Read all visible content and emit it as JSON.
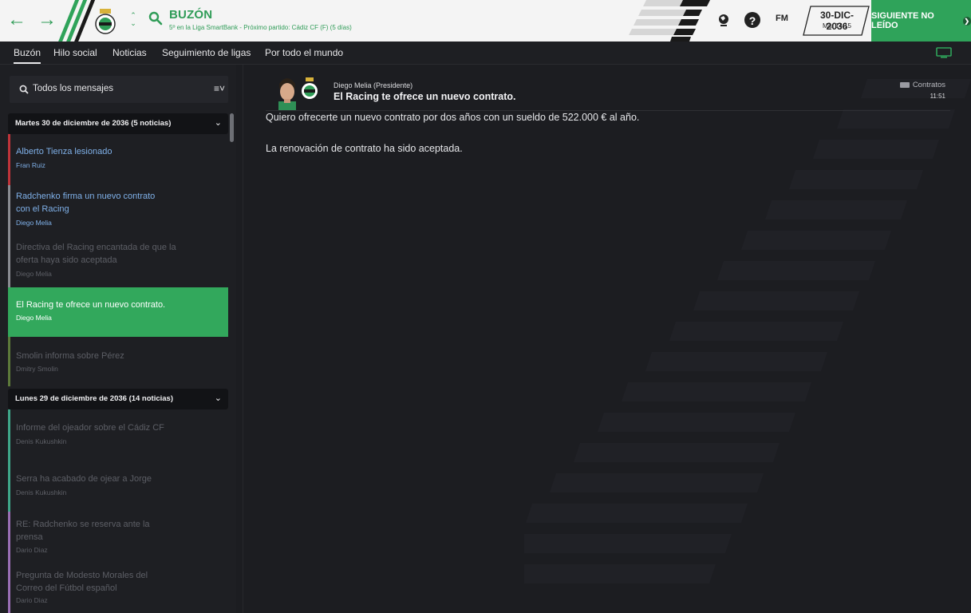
{
  "header": {
    "title": "BUZÓN",
    "subtitle": "5º en la Liga SmartBank - Próximo partido: Cádiz CF (F)  (5 días)",
    "date": "30-DIC-2036",
    "weekday_time": "Mar 14:15",
    "fm_logo": "FM",
    "help_label": "?",
    "continue_label": "SIGUIENTE NO LEÍDO",
    "icons": [
      "back-arrow-icon",
      "forward-arrow-icon",
      "club-crest-icon",
      "up-down-chevron-icon",
      "search-icon",
      "world-icon",
      "help-icon",
      "fm-logo-icon",
      "continue-arrow-icon"
    ],
    "brand_color": "#2fa35a"
  },
  "tabs": [
    {
      "label": "Buzón",
      "active": true
    },
    {
      "label": "Hilo social",
      "active": false
    },
    {
      "label": "Noticias",
      "active": false
    },
    {
      "label": "Seguimiento de ligas",
      "active": false
    },
    {
      "label": "Por todo el mundo",
      "active": false
    }
  ],
  "sidebar": {
    "search_label": "Todos los mensajes",
    "groups": [
      {
        "label": "Martes 30 de diciembre de 2036 (5 noticias)",
        "messages": [
          {
            "title": "Alberto Tienza lesionado",
            "sender": "Fran Ruiz",
            "state": "unread",
            "color": "#c0343a"
          },
          {
            "title": "Radchenko firma un nuevo contrato con el Racing",
            "sender": "Diego Melia",
            "state": "unread",
            "color": "#8a8c92"
          },
          {
            "title": "Directiva del Racing encantada de que la oferta haya sido aceptada",
            "sender": "Diego Melia",
            "state": "read",
            "color": "#8a8c92"
          },
          {
            "title": "El Racing te ofrece un nuevo contrato.",
            "sender": "Diego Melia",
            "state": "selected",
            "color": "#32a85c"
          },
          {
            "title": "Smolin informa sobre Pérez",
            "sender": "Dmitry Smolin",
            "state": "read",
            "color": "#5d7a3a"
          }
        ]
      },
      {
        "label": "Lunes 29 de diciembre de 2036 (14 noticias)",
        "messages": [
          {
            "title": "Informe del ojeador sobre el Cádiz CF",
            "sender": "Denis Kukushkin",
            "state": "read",
            "color": "#3fa88a"
          },
          {
            "title": "Serra ha acabado de ojear a Jorge",
            "sender": "Denis Kukushkin",
            "state": "read",
            "color": "#3fa88a"
          },
          {
            "title": "RE: Radchenko se reserva ante la prensa",
            "sender": "Dario Diaz",
            "state": "read",
            "color": "#9a6fb5"
          },
          {
            "title": "Pregunta de Modesto Morales del Correo del Fútbol español",
            "sender": "Dario Diaz",
            "state": "read",
            "color": "#9a6fb5"
          }
        ]
      }
    ]
  },
  "message": {
    "from_name": "Diego Melia",
    "from_role": "(Presidente)",
    "subject": "El Racing te ofrece un nuevo contrato.",
    "category": "Contratos",
    "time": "11:51",
    "body": [
      "Quiero ofrecerte un nuevo contrato por dos años con un sueldo de 522.000 € al año.",
      "La renovación de contrato ha sido aceptada."
    ]
  }
}
